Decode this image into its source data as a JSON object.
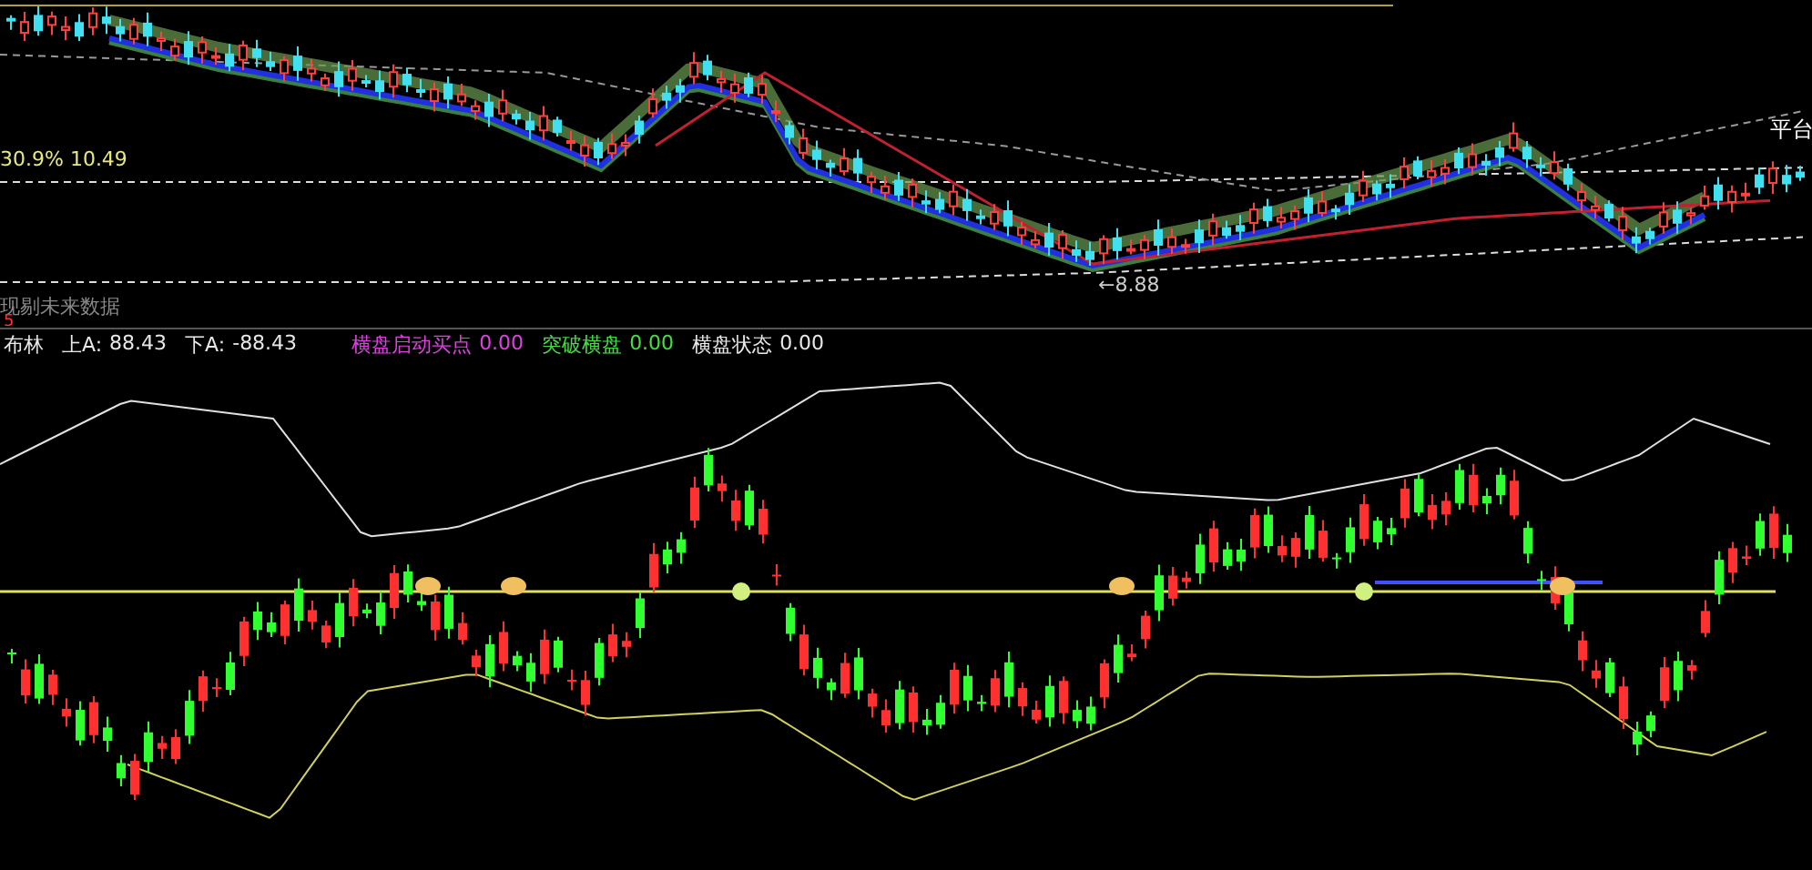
{
  "price_panel": {
    "range_label": "30.9% 10.49",
    "low_label": "←8.88",
    "platform_label": "平台",
    "note": "现剔未来数据",
    "period": "5"
  },
  "indicator_panel": {
    "title": "布林",
    "readings": [
      {
        "name": "上A:",
        "value": "88.43",
        "color": "#e8e8e8"
      },
      {
        "name": "下A:",
        "value": "-88.43",
        "color": "#e8e8e8"
      },
      {
        "name": "横盘启动买点",
        "value": "0.00",
        "color": "#e040e0"
      },
      {
        "name": "突破横盘",
        "value": "0.00",
        "color": "#40e040"
      },
      {
        "name": "横盘状态",
        "value": "0.00",
        "color": "#e8e8e8"
      }
    ]
  }
}
